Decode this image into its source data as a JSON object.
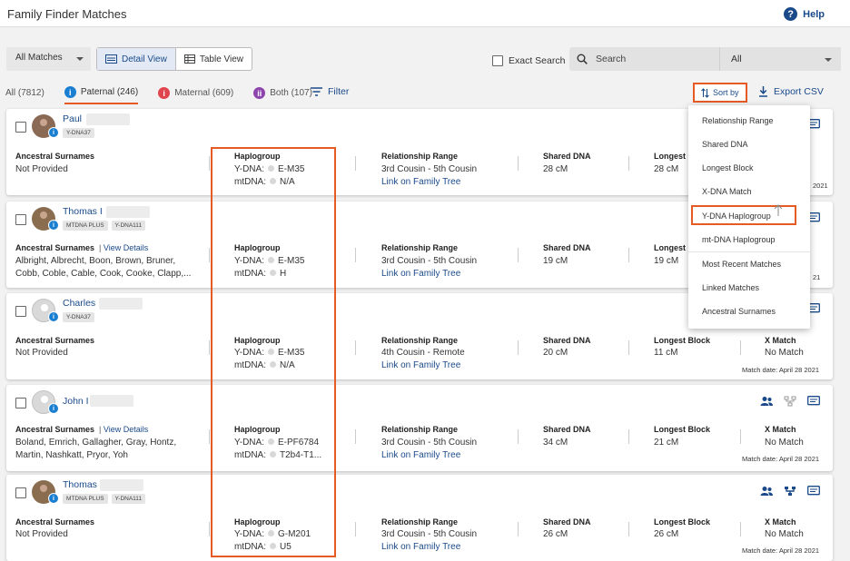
{
  "header": {
    "title": "Family Finder Matches",
    "help_label": "Help"
  },
  "controls": {
    "filter_select": "All Matches",
    "detail_view": "Detail View",
    "table_view": "Table View",
    "exact_search": "Exact Search",
    "search_placeholder": "Search",
    "search_scope": "All"
  },
  "tabs": [
    {
      "label": "All (7812)"
    },
    {
      "label": "Paternal (246)"
    },
    {
      "label": "Maternal (609)"
    },
    {
      "label": "Both (107)"
    }
  ],
  "toolbar": {
    "filter_label": "Filter",
    "sort_label": "Sort by",
    "export_label": "Export CSV"
  },
  "labels": {
    "ancestral_surnames": "Ancestral Surnames",
    "view_details": "View Details",
    "haplogroup": "Haplogroup",
    "ydna": "Y-DNA:",
    "mtdna": "mtDNA:",
    "relationship_range": "Relationship Range",
    "link_tree": "Link on Family Tree",
    "shared_dna": "Shared DNA",
    "longest_block": "Longest Block",
    "longest_block_cut": "Longest B",
    "x_match": "X Match"
  },
  "matches": [
    {
      "name": "Paul",
      "tags": [
        "Y-DNA37"
      ],
      "surnames_line1": "Not Provided",
      "surnames_line2": "",
      "ydna": "E-M35",
      "mtdna": "N/A",
      "relationship": "3rd Cousin - 5th Cousin",
      "shared": "28 cM",
      "longest": "28 cM",
      "x_match": "",
      "date_tail": "2021"
    },
    {
      "name": "Thomas I",
      "tags": [
        "MTDNA PLUS",
        "Y-DNA111"
      ],
      "surnames_line1": "Albright, Albrecht, Boon, Brown, Bruner,",
      "surnames_line2": "Cobb, Coble, Cable, Cook, Cooke, Clapp,...",
      "ydna": "E-M35",
      "mtdna": "H",
      "relationship": "3rd Cousin - 5th Cousin",
      "shared": "19 cM",
      "longest": "19 cM",
      "x_match": "",
      "date_tail": "21"
    },
    {
      "name": "Charles",
      "tags": [
        "Y-DNA37"
      ],
      "surnames_line1": "Not Provided",
      "surnames_line2": "",
      "ydna": "E-M35",
      "mtdna": "N/A",
      "relationship": "4th Cousin - Remote",
      "shared": "20 cM",
      "longest": "11 cM",
      "x_match": "No Match",
      "date": "Match date: April 28 2021"
    },
    {
      "name": "John I",
      "tags": [],
      "surnames_line1": "Boland, Emrich, Gallagher, Gray, Hontz,",
      "surnames_line2": "Martin, Nashkatt, Pryor, Yoh",
      "ydna": "E-PF6784",
      "mtdna": "T2b4-T1...",
      "relationship": "3rd Cousin - 5th Cousin",
      "shared": "34 cM",
      "longest": "21 cM",
      "x_match": "No Match",
      "date": "Match date: April 28 2021"
    },
    {
      "name": "Thomas",
      "tags": [
        "MTDNA PLUS",
        "Y-DNA111"
      ],
      "surnames_line1": "Not Provided",
      "surnames_line2": "",
      "ydna": "G-M201",
      "mtdna": "U5",
      "relationship": "3rd Cousin - 5th Cousin",
      "shared": "26 cM",
      "longest": "26 cM",
      "x_match": "No Match",
      "date": "Match date: April 28 2021"
    }
  ],
  "sort_menu": [
    "Relationship Range",
    "Shared DNA",
    "Longest Block",
    "X-DNA Match",
    "Y-DNA Haplogroup",
    "mt-DNA Haplogroup",
    "Most Recent Matches",
    "Linked Matches",
    "Ancestral Surnames"
  ],
  "colors": {
    "accent": "#e65a23",
    "link": "#1a4a8a",
    "male": "#1a7fd1",
    "female": "#e0444c",
    "both": "#8e44ad"
  }
}
